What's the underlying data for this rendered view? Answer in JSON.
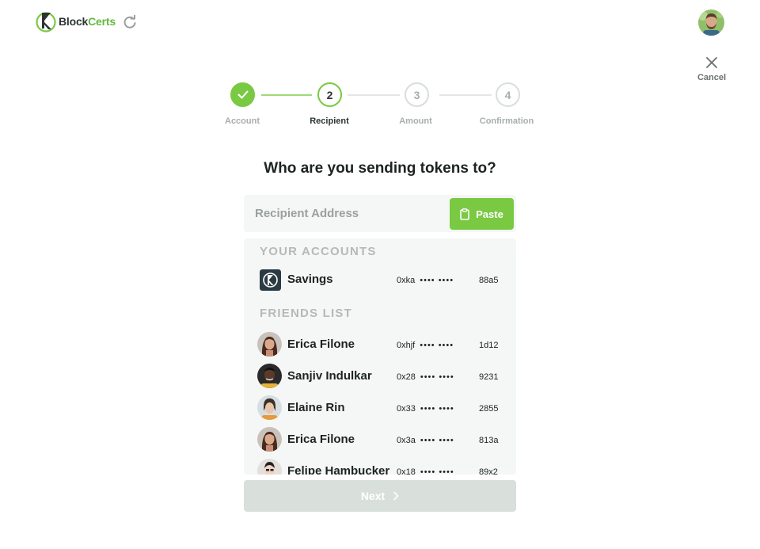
{
  "app": {
    "name_part1": "Block",
    "name_part2": "Certs",
    "brand_color": "#7ac943"
  },
  "header": {
    "cancel_label": "Cancel"
  },
  "steps": [
    {
      "number": "1",
      "label": "Account",
      "state": "done"
    },
    {
      "number": "2",
      "label": "Recipient",
      "state": "active"
    },
    {
      "number": "3",
      "label": "Amount",
      "state": "pending"
    },
    {
      "number": "4",
      "label": "Confirmation",
      "state": "pending"
    }
  ],
  "main": {
    "question": "Who are you sending tokens to?",
    "recipient_placeholder": "Recipient Address",
    "paste_label": "Paste",
    "next_label": "Next"
  },
  "accounts_section": {
    "title": "YOUR ACCOUNTS",
    "items": [
      {
        "name": "Savings",
        "addr_start": "0xka",
        "addr_end": "88a5"
      }
    ]
  },
  "friends_section": {
    "title": "FRIENDS LIST",
    "items": [
      {
        "name": "Erica Filone",
        "addr_start": "0xhjf",
        "addr_end": "1d12"
      },
      {
        "name": "Sanjiv Indulkar",
        "addr_start": "0x28",
        "addr_end": "9231"
      },
      {
        "name": "Elaine Rin",
        "addr_start": "0x33",
        "addr_end": "2855"
      },
      {
        "name": "Erica Filone",
        "addr_start": "0x3a",
        "addr_end": "813a"
      },
      {
        "name": "Felipe Hambucker",
        "addr_start": "0x18",
        "addr_end": "89x2"
      }
    ]
  },
  "address_mask": "•••• ••••"
}
